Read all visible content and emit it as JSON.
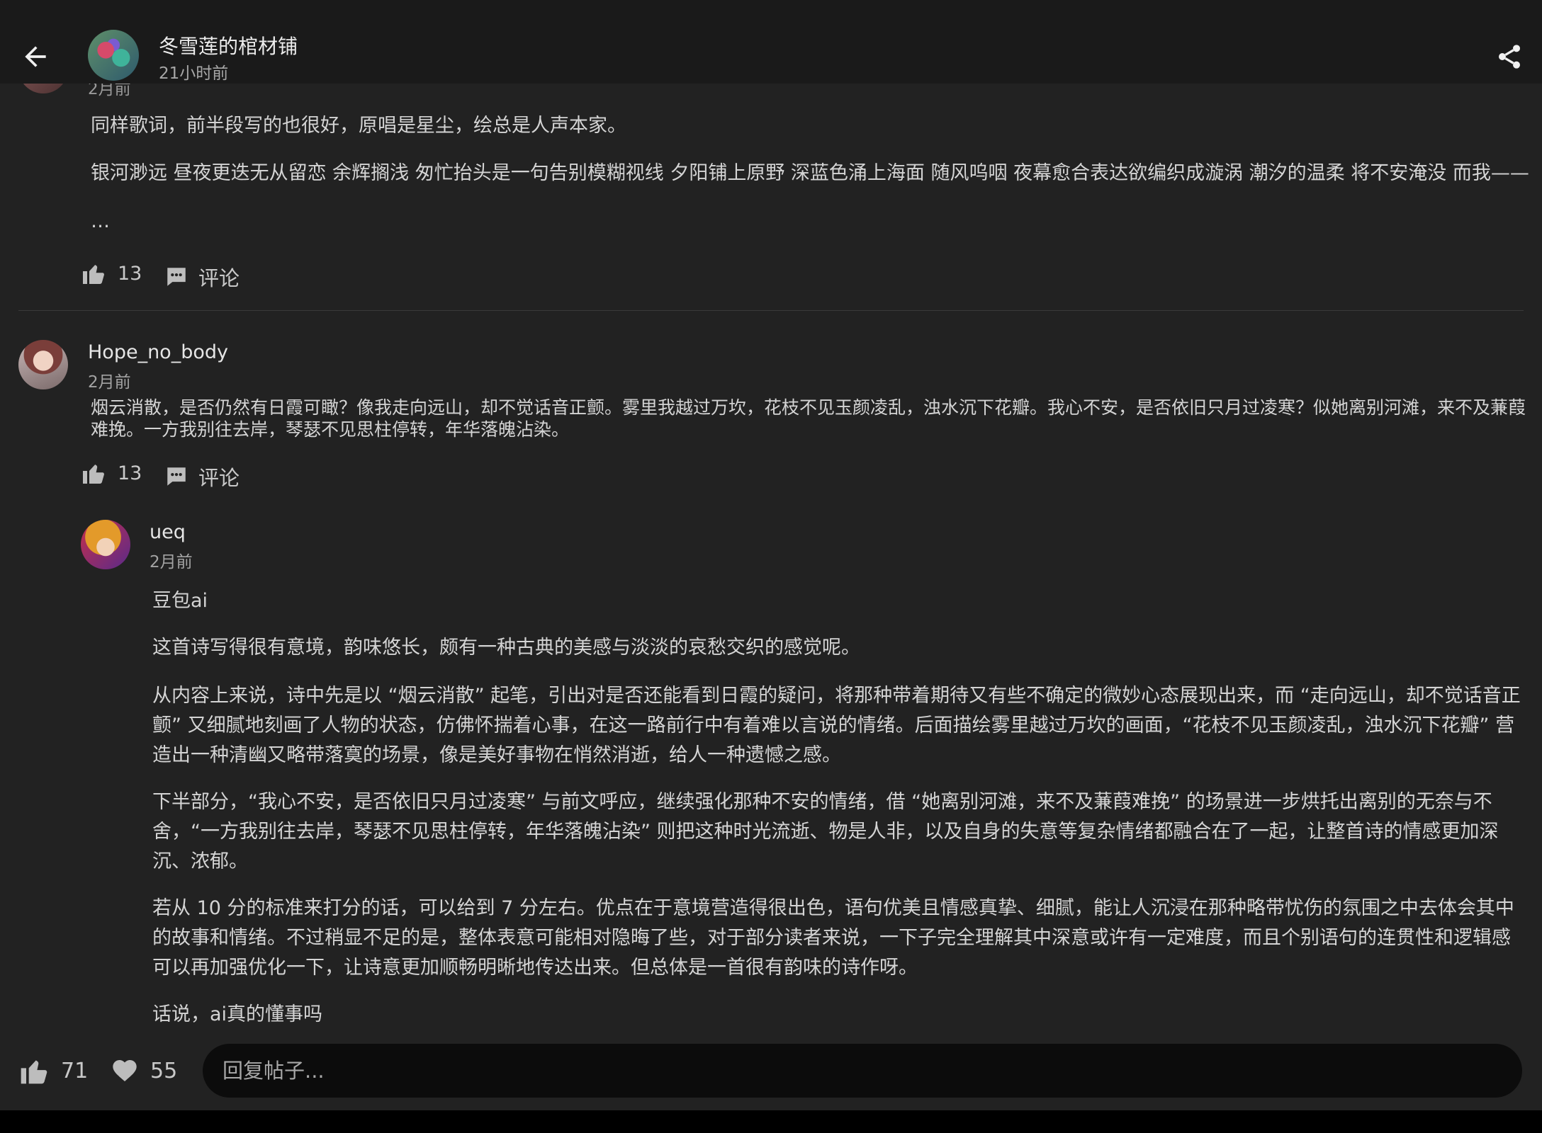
{
  "header": {
    "title": "冬雪莲的棺材铺",
    "time": "21小时前"
  },
  "partial_comment": {
    "time": "2月前",
    "paragraphs": [
      "同样歌词，前半段写的也很好，原唱是星尘，绘总是人声本家。",
      "银河渺远 昼夜更迭无从留恋 余辉搁浅 匆忙抬头是一句告别模糊视线 夕阳铺上原野 深蓝色涌上海面 随风呜咽 夜幕愈合表达欲编织成漩涡 潮汐的温柔 将不安淹没 而我——",
      "…"
    ],
    "likes": "13",
    "comment_label": "评论"
  },
  "comment2": {
    "username": "Hope_no_body",
    "time": "2月前",
    "lines": [
      "烟云消散，是否仍然有日霞可瞰？像我走向远山，却不觉话音正颤。雾里我越过万坎，花枝不见玉颜凌乱，浊水沉下花瓣。我心不安，是否依旧只月过凌寒？似她离别河滩，来不及蒹葭",
      "难挽。一方我别往去岸，琴瑟不见思柱停转，年华落魄沾染。"
    ],
    "likes": "13",
    "comment_label": "评论"
  },
  "reply": {
    "username": "ueq",
    "time": "2月前",
    "p1": "豆包ai",
    "p2": "这首诗写得很有意境，韵味悠长，颇有一种古典的美感与淡淡的哀愁交织的感觉呢。",
    "p3_lines": [
      "从内容上来说，诗中先是以 “烟云消散” 起笔，引出对是否还能看到日霞的疑问，将那种带着期待又有些不确定的微妙心态展现出来，而 “走向远山，却不觉话音正",
      "颤” 又细腻地刻画了人物的状态，仿佛怀揣着心事，在这一路前行中有着难以言说的情绪。后面描绘雾里越过万坎的画面，“花枝不见玉颜凌乱，浊水沉下花瓣” 营",
      "造出一种清幽又略带落寞的场景，像是美好事物在悄然消逝，给人一种遗憾之感。"
    ],
    "p4_lines": [
      "下半部分，“我心不安，是否依旧只月过凌寒” 与前文呼应，继续强化那种不安的情绪，借 “她离别河滩，来不及蒹葭难挽” 的场景进一步烘托出离别的无奈与不",
      "舍，“一方我别往去岸，琴瑟不见思柱停转，年华落魄沾染” 则把这种时光流逝、物是人非，以及自身的失意等复杂情绪都融合在了一起，让整首诗的情感更加深",
      "沉、浓郁。"
    ],
    "p5_lines": [
      "若从 10 分的标准来打分的话，可以给到 7 分左右。优点在于意境营造得很出色，语句优美且情感真挚、细腻，能让人沉浸在那种略带忧伤的氛围之中去体会其中",
      "的故事和情绪。不过稍显不足的是，整体表意可能相对隐晦了些，对于部分读者来说，一下子完全理解其中深意或许有一定难度，而且个别语句的连贯性和逻辑感",
      "可以再加强优化一下，让诗意更加顺畅明晰地传达出来。但总体是一首很有韵味的诗作呀。"
    ],
    "p6": "话说，ai真的懂事吗"
  },
  "bottom": {
    "likes": "71",
    "favorites": "55",
    "reply_placeholder": "回复帖子..."
  },
  "icons": {
    "back": "back-arrow-icon",
    "share": "share-icon",
    "like": "thumbs-up-icon",
    "comment": "comment-bubble-icon",
    "favorite": "heart-icon"
  },
  "colors": {
    "background": "#222222",
    "header": "#1a1a1a",
    "input": "#0c0c0c",
    "text": "#d4d4d4",
    "muted": "#a6a6a6"
  }
}
